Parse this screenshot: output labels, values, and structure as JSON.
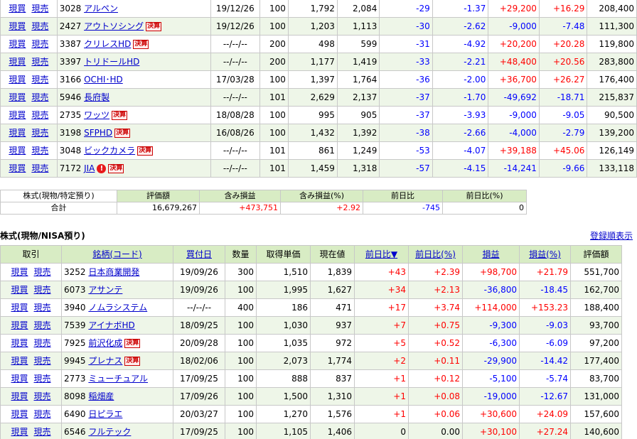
{
  "actions": {
    "buy": "現買",
    "sell": "現売"
  },
  "top_rows": [
    {
      "code": "3028",
      "name": "アルペン",
      "badge": "",
      "alert": false,
      "date": "19/12/26",
      "qty": "100",
      "cost": "1,792",
      "price": "2,084",
      "chg": "-29",
      "chg_pct": "-1.37",
      "pl": "+29,200",
      "pl_pct": "+16.29",
      "value": "208,400"
    },
    {
      "code": "2427",
      "name": "アウトソシング",
      "badge": "決算",
      "alert": false,
      "date": "19/12/26",
      "qty": "100",
      "cost": "1,203",
      "price": "1,113",
      "chg": "-30",
      "chg_pct": "-2.62",
      "pl": "-9,000",
      "pl_pct": "-7.48",
      "value": "111,300"
    },
    {
      "code": "3387",
      "name": "クリレスHD",
      "badge": "決算",
      "alert": false,
      "date": "--/--/--",
      "qty": "200",
      "cost": "498",
      "price": "599",
      "chg": "-31",
      "chg_pct": "-4.92",
      "pl": "+20,200",
      "pl_pct": "+20.28",
      "value": "119,800"
    },
    {
      "code": "3397",
      "name": "トリドールHD",
      "badge": "",
      "alert": false,
      "date": "--/--/--",
      "qty": "200",
      "cost": "1,177",
      "price": "1,419",
      "chg": "-33",
      "chg_pct": "-2.21",
      "pl": "+48,400",
      "pl_pct": "+20.56",
      "value": "283,800"
    },
    {
      "code": "3166",
      "name": "OCHI･HD",
      "badge": "",
      "alert": false,
      "date": "17/03/28",
      "qty": "100",
      "cost": "1,397",
      "price": "1,764",
      "chg": "-36",
      "chg_pct": "-2.00",
      "pl": "+36,700",
      "pl_pct": "+26.27",
      "value": "176,400"
    },
    {
      "code": "5946",
      "name": "長府製",
      "badge": "",
      "alert": false,
      "date": "--/--/--",
      "qty": "101",
      "cost": "2,629",
      "price": "2,137",
      "chg": "-37",
      "chg_pct": "-1.70",
      "pl": "-49,692",
      "pl_pct": "-18.71",
      "value": "215,837"
    },
    {
      "code": "2735",
      "name": "ワッツ",
      "badge": "決算",
      "alert": false,
      "date": "18/08/28",
      "qty": "100",
      "cost": "995",
      "price": "905",
      "chg": "-37",
      "chg_pct": "-3.93",
      "pl": "-9,000",
      "pl_pct": "-9.05",
      "value": "90,500"
    },
    {
      "code": "3198",
      "name": "SFPHD",
      "badge": "決算",
      "alert": false,
      "date": "16/08/26",
      "qty": "100",
      "cost": "1,432",
      "price": "1,392",
      "chg": "-38",
      "chg_pct": "-2.66",
      "pl": "-4,000",
      "pl_pct": "-2.79",
      "value": "139,200"
    },
    {
      "code": "3048",
      "name": "ビックカメラ",
      "badge": "決算",
      "alert": false,
      "date": "--/--/--",
      "qty": "101",
      "cost": "861",
      "price": "1,249",
      "chg": "-53",
      "chg_pct": "-4.07",
      "pl": "+39,188",
      "pl_pct": "+45.06",
      "value": "126,149"
    },
    {
      "code": "7172",
      "name": "JIA",
      "badge": "決算",
      "alert": true,
      "date": "--/--/--",
      "qty": "101",
      "cost": "1,459",
      "price": "1,318",
      "chg": "-57",
      "chg_pct": "-4.15",
      "pl": "-14,241",
      "pl_pct": "-9.66",
      "value": "133,118"
    }
  ],
  "summary": {
    "label1": "株式(現物/特定預り)",
    "label2": "合計",
    "headers": [
      "評価額",
      "含み損益",
      "含み損益(%)",
      "前日比",
      "前日比(%)"
    ],
    "values": [
      "16,679,267",
      "+473,751",
      "+2.92",
      "-745",
      "0"
    ]
  },
  "nisa": {
    "title": "株式(現物/NISA預り)",
    "sort_link": "登録順表示",
    "headers": [
      "取引",
      "銘柄(コード)",
      "買付日",
      "数量",
      "取得単価",
      "現在値",
      "前日比▼",
      "前日比(%)",
      "損益",
      "損益(%)",
      "評価額"
    ],
    "rows": [
      {
        "code": "3252",
        "name": "日本商業開発",
        "badge": "",
        "date": "19/09/26",
        "qty": "300",
        "cost": "1,510",
        "price": "1,839",
        "chg": "+43",
        "chg_pct": "+2.39",
        "pl": "+98,700",
        "pl_pct": "+21.79",
        "value": "551,700"
      },
      {
        "code": "6073",
        "name": "アサンテ",
        "badge": "",
        "date": "19/09/26",
        "qty": "100",
        "cost": "1,995",
        "price": "1,627",
        "chg": "+34",
        "chg_pct": "+2.13",
        "pl": "-36,800",
        "pl_pct": "-18.45",
        "value": "162,700"
      },
      {
        "code": "3940",
        "name": "ノムラシステム",
        "badge": "",
        "date": "--/--/--",
        "qty": "400",
        "cost": "186",
        "price": "471",
        "chg": "+17",
        "chg_pct": "+3.74",
        "pl": "+114,000",
        "pl_pct": "+153.23",
        "value": "188,400"
      },
      {
        "code": "7539",
        "name": "アイナボHD",
        "badge": "",
        "date": "18/09/25",
        "qty": "100",
        "cost": "1,030",
        "price": "937",
        "chg": "+7",
        "chg_pct": "+0.75",
        "pl": "-9,300",
        "pl_pct": "-9.03",
        "value": "93,700"
      },
      {
        "code": "7925",
        "name": "前沢化成",
        "badge": "決算",
        "date": "20/09/28",
        "qty": "100",
        "cost": "1,035",
        "price": "972",
        "chg": "+5",
        "chg_pct": "+0.52",
        "pl": "-6,300",
        "pl_pct": "-6.09",
        "value": "97,200"
      },
      {
        "code": "9945",
        "name": "プレナス",
        "badge": "決算",
        "date": "18/02/06",
        "qty": "100",
        "cost": "2,073",
        "price": "1,774",
        "chg": "+2",
        "chg_pct": "+0.11",
        "pl": "-29,900",
        "pl_pct": "-14.42",
        "value": "177,400"
      },
      {
        "code": "2773",
        "name": "ミューチュアル",
        "badge": "",
        "date": "17/09/25",
        "qty": "100",
        "cost": "888",
        "price": "837",
        "chg": "+1",
        "chg_pct": "+0.12",
        "pl": "-5,100",
        "pl_pct": "-5.74",
        "value": "83,700"
      },
      {
        "code": "8098",
        "name": "稲畑産",
        "badge": "",
        "date": "17/09/26",
        "qty": "100",
        "cost": "1,500",
        "price": "1,310",
        "chg": "+1",
        "chg_pct": "+0.08",
        "pl": "-19,000",
        "pl_pct": "-12.67",
        "value": "131,000"
      },
      {
        "code": "6490",
        "name": "日ピラエ",
        "badge": "",
        "date": "20/03/27",
        "qty": "100",
        "cost": "1,270",
        "price": "1,576",
        "chg": "+1",
        "chg_pct": "+0.06",
        "pl": "+30,600",
        "pl_pct": "+24.09",
        "value": "157,600"
      },
      {
        "code": "6546",
        "name": "フルテック",
        "badge": "",
        "date": "17/09/25",
        "qty": "100",
        "cost": "1,105",
        "price": "1,406",
        "chg": "0",
        "chg_pct": "0.00",
        "pl": "+30,100",
        "pl_pct": "+27.24",
        "value": "140,600"
      }
    ]
  },
  "colors": {
    "header_bg": "#d8ecc4",
    "alt_row": "#eef6e8",
    "positive": "#ff0000",
    "negative": "#0000ff",
    "link": "#0000cc"
  }
}
